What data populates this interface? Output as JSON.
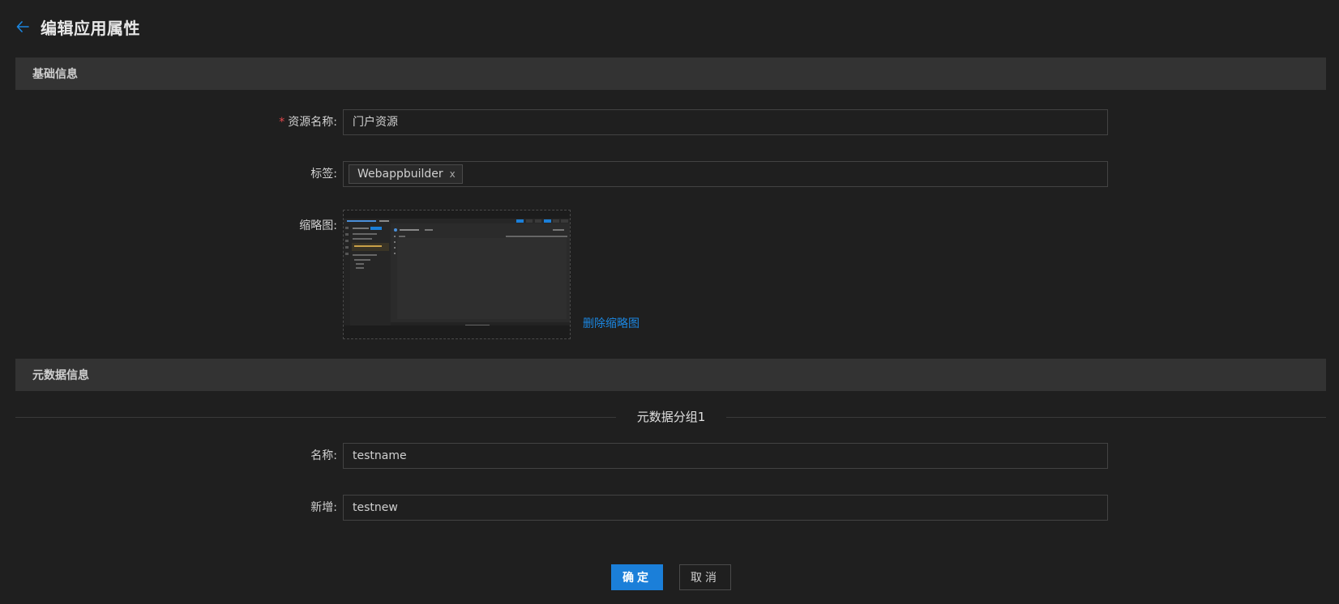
{
  "header": {
    "title": "编辑应用属性"
  },
  "sections": {
    "basic": "基础信息",
    "metadata": "元数据信息"
  },
  "basic_form": {
    "resource_name": {
      "label": "资源名称:",
      "required_mark": "*",
      "value": "门户资源"
    },
    "tags": {
      "label": "标签:",
      "items": [
        "Webappbuilder"
      ],
      "close_glyph": "x"
    },
    "thumbnail": {
      "label": "缩略图:",
      "delete_link": "删除缩略图"
    }
  },
  "metadata_form": {
    "group_title": "元数据分组1",
    "name": {
      "label": "名称:",
      "value": "testname"
    },
    "new_field": {
      "label": "新增:",
      "value": "testnew"
    }
  },
  "actions": {
    "confirm": "确定",
    "cancel": "取消"
  },
  "colors": {
    "background": "#1f1f1f",
    "section_bar": "#333333",
    "accent": "#1b7fd9",
    "link": "#1b86e0",
    "required": "#e5484d"
  },
  "icons": {
    "back": "arrow-left-icon",
    "tag_close": "close-icon"
  }
}
